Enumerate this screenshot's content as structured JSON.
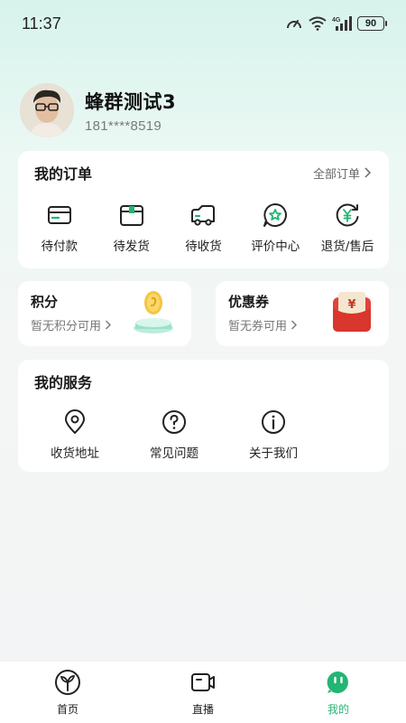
{
  "status_bar": {
    "time": "11:37",
    "battery": "90",
    "network": "4G",
    "icons": [
      "speed-icon",
      "wifi-icon",
      "signal-icon",
      "battery-icon"
    ]
  },
  "profile": {
    "name": "蜂群测试3",
    "phone": "181****8519"
  },
  "orders": {
    "title": "我的订单",
    "all_label": "全部订单",
    "items": [
      {
        "label": "待付款",
        "icon": "card-icon"
      },
      {
        "label": "待发货",
        "icon": "box-icon"
      },
      {
        "label": "待收货",
        "icon": "truck-icon"
      },
      {
        "label": "评价中心",
        "icon": "star-chat-icon"
      },
      {
        "label": "退货/售后",
        "icon": "yuan-return-icon"
      }
    ]
  },
  "points": {
    "title": "积分",
    "subtitle": "暂无积分可用"
  },
  "coupons": {
    "title": "优惠券",
    "subtitle": "暂无券可用",
    "badge_symbol": "¥"
  },
  "services": {
    "title": "我的服务",
    "items": [
      {
        "label": "收货地址",
        "icon": "location-pin-icon"
      },
      {
        "label": "常见问题",
        "icon": "question-icon"
      },
      {
        "label": "关于我们",
        "icon": "info-icon"
      }
    ]
  },
  "nav": {
    "items": [
      {
        "label": "首页",
        "icon": "sprout-icon",
        "active": false
      },
      {
        "label": "直播",
        "icon": "camera-icon",
        "active": false
      },
      {
        "label": "我的",
        "icon": "face-icon",
        "active": true
      }
    ]
  },
  "colors": {
    "accent": "#22b573",
    "background_top": "#d7f3ec",
    "card": "#ffffff",
    "coupon_red": "#e0443a"
  }
}
